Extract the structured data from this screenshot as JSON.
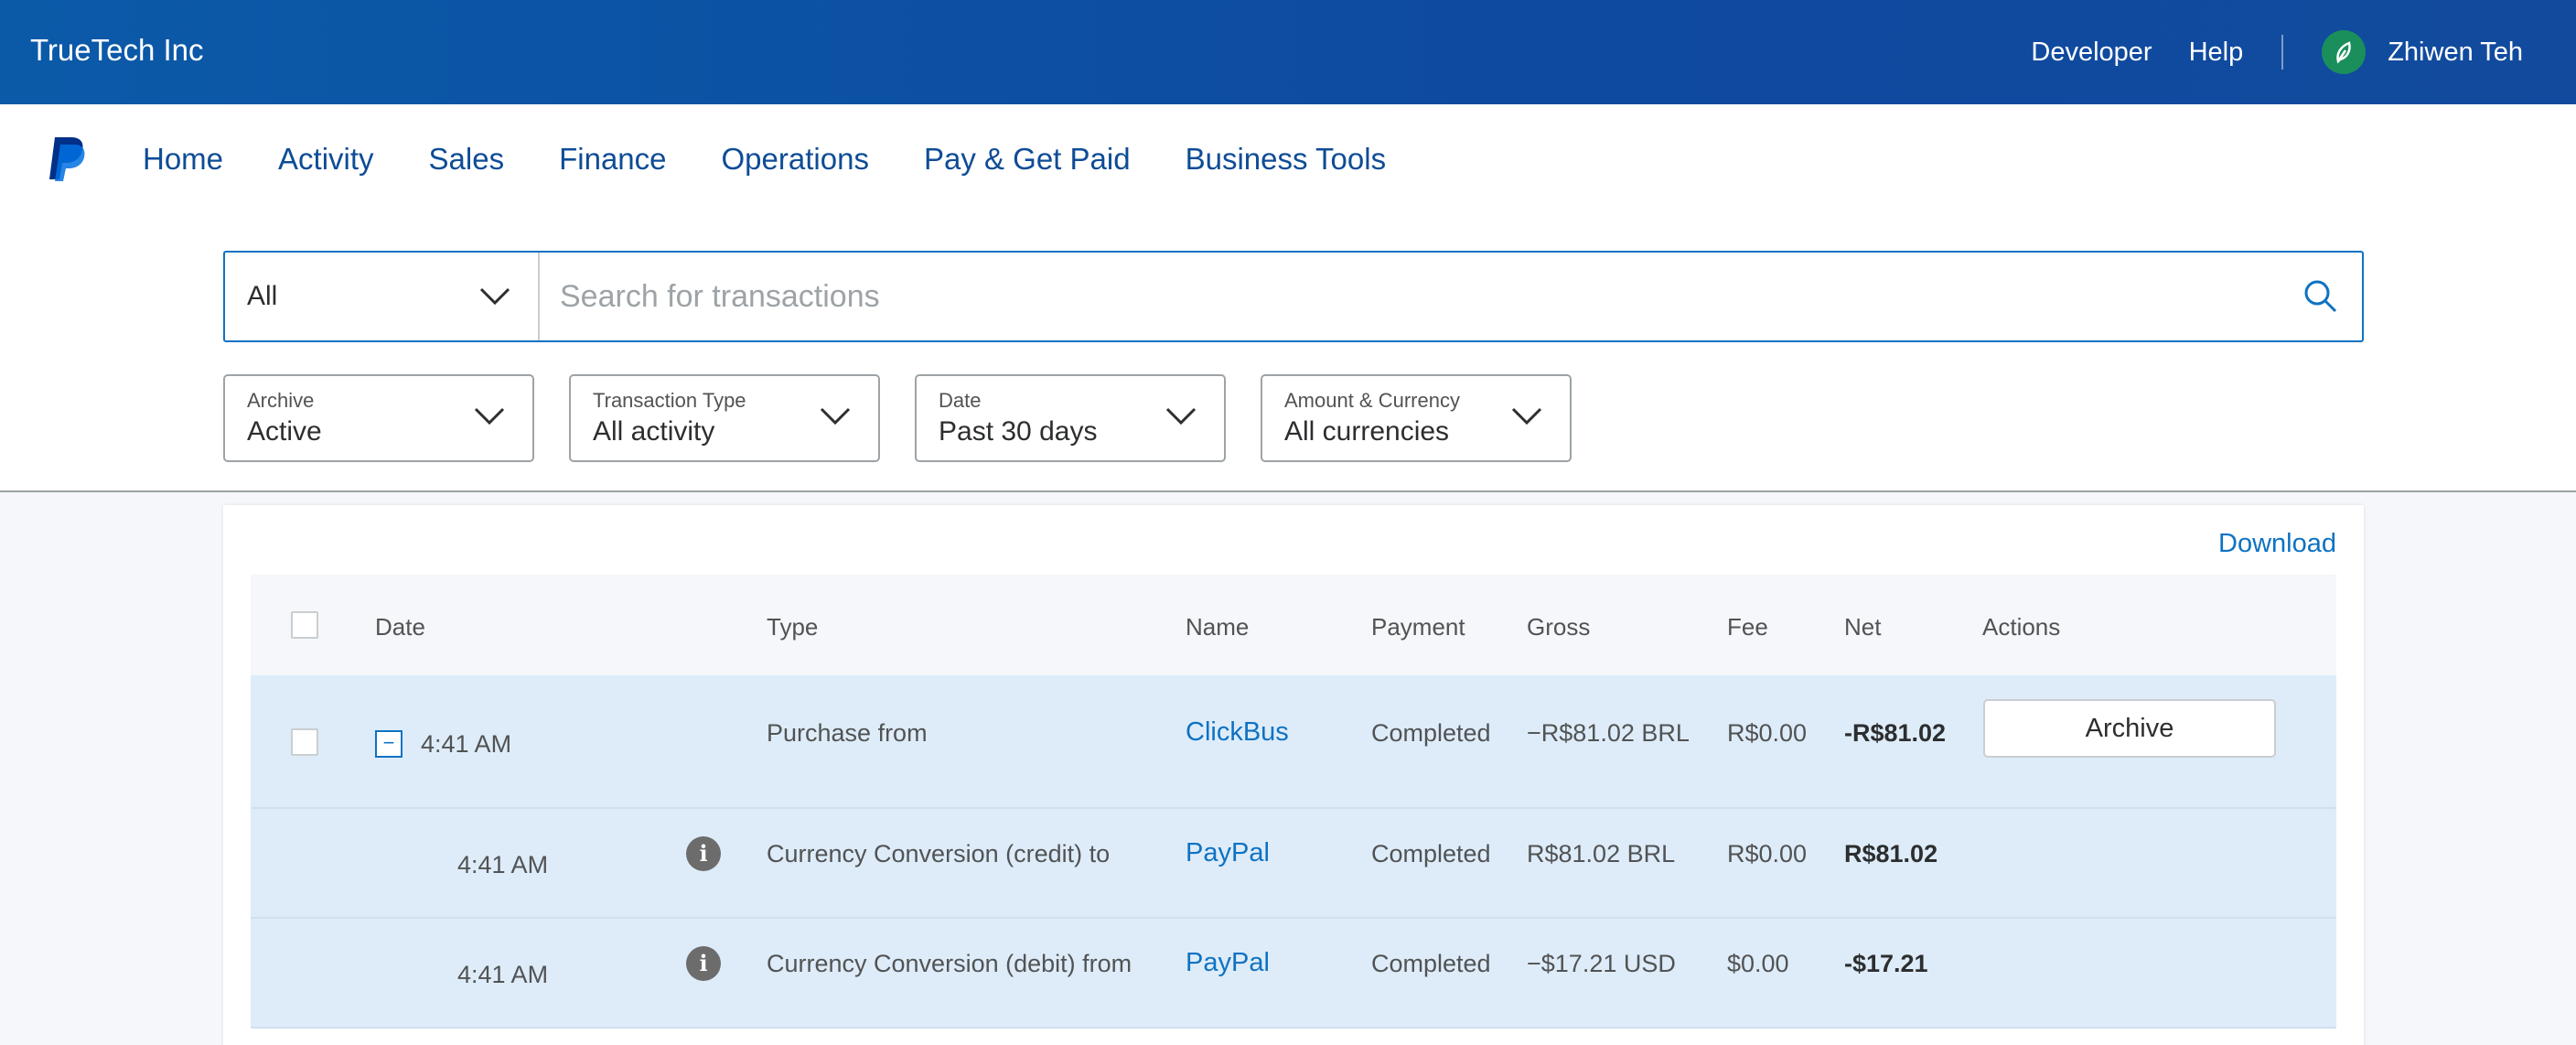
{
  "header": {
    "company": "TrueTech Inc",
    "links": [
      "Developer",
      "Help"
    ],
    "user_name": "Zhiwen Teh"
  },
  "nav": {
    "items": [
      "Home",
      "Activity",
      "Sales",
      "Finance",
      "Operations",
      "Pay & Get Paid",
      "Business Tools"
    ]
  },
  "search": {
    "scope": "All",
    "placeholder": "Search for transactions"
  },
  "filters": [
    {
      "label": "Archive",
      "value": "Active"
    },
    {
      "label": "Transaction Type",
      "value": "All activity"
    },
    {
      "label": "Date",
      "value": "Past 30 days"
    },
    {
      "label": "Amount & Currency",
      "value": "All currencies"
    }
  ],
  "download_label": "Download",
  "table": {
    "columns": [
      "Date",
      "Type",
      "Name",
      "Payment",
      "Gross",
      "Fee",
      "Net",
      "Actions"
    ],
    "rows": [
      {
        "time": "4:41 AM",
        "type": "Purchase from",
        "name": "ClickBus",
        "payment": "Completed",
        "gross": "−R$81.02 BRL",
        "fee": "R$0.00",
        "net": "-R$81.02",
        "action": "Archive"
      },
      {
        "time": "4:41 AM",
        "type": "Currency Conversion (credit) to",
        "name": "PayPal",
        "payment": "Completed",
        "gross": "R$81.02 BRL",
        "fee": "R$0.00",
        "net": "R$81.02"
      },
      {
        "time": "4:41 AM",
        "type": "Currency Conversion (debit) from",
        "name": "PayPal",
        "payment": "Completed",
        "gross": "−$17.21 USD",
        "fee": "$0.00",
        "net": "-$17.21"
      }
    ]
  },
  "colors": {
    "header_bg": "#0b5aa8",
    "nav_text": "#0e4c96",
    "link": "#0e72c2",
    "row_highlight": "#deecf9"
  }
}
